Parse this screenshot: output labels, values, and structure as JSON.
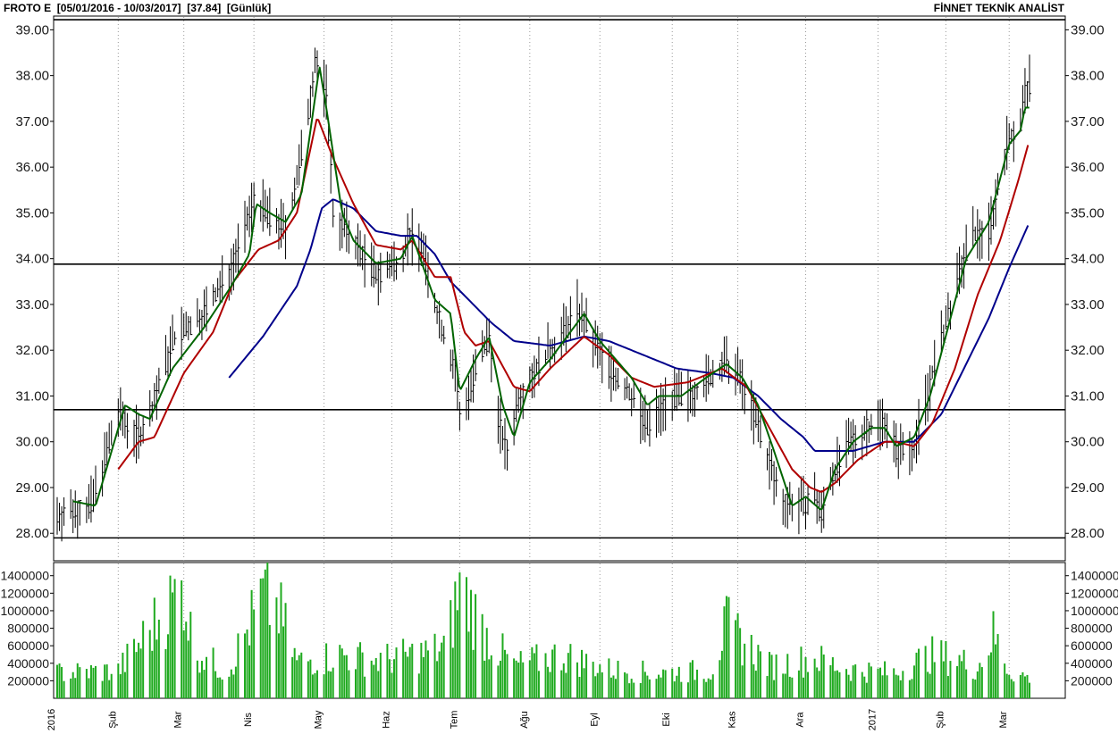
{
  "header": {
    "left": "FROTO E  [05/01/2016 - 10/03/2017]  [37.84]  [Günlük]",
    "right": "FİNNET TEKNİK ANALİST"
  },
  "colors": {
    "price_bars": "#000000",
    "ma_short": "#006400",
    "ma_mid": "#b00000",
    "ma_long": "#00008b",
    "volume": "#1faa1f",
    "grid": "#9a9a9a",
    "level_lines": "#000000"
  },
  "chart_data": [
    {
      "type": "line",
      "title": "",
      "ylim": [
        27.4,
        39.3
      ],
      "y_ticks": [
        "28.00",
        "29.00",
        "30.00",
        "31.00",
        "32.00",
        "33.00",
        "34.00",
        "35.00",
        "36.00",
        "37.00",
        "38.00",
        "39.00"
      ],
      "x_ticks": [
        "2016",
        "Şub",
        "Mar",
        "Nis",
        "May",
        "Haz",
        "Tem",
        "Ağu",
        "Eyl",
        "Eki",
        "Kas",
        "Ara",
        "2017",
        "Şub",
        "Mar"
      ],
      "grid": true,
      "horizontal_levels": [
        39.22,
        33.88,
        30.7,
        27.9
      ],
      "price_anchors": [
        [
          "2016-01-05",
          28.4
        ],
        [
          "2016-01-20",
          28.6
        ],
        [
          "2016-02-01",
          30.6
        ],
        [
          "2016-02-10",
          30.1
        ],
        [
          "2016-02-15",
          30.6
        ],
        [
          "2016-02-25",
          32.2
        ],
        [
          "2016-03-10",
          32.8
        ],
        [
          "2016-03-21",
          33.7
        ],
        [
          "2016-03-28",
          34.6
        ],
        [
          "2016-04-01",
          35.3
        ],
        [
          "2016-04-08",
          34.9
        ],
        [
          "2016-04-15",
          34.6
        ],
        [
          "2016-04-22",
          36.2
        ],
        [
          "2016-04-28",
          38.3
        ],
        [
          "2016-05-03",
          37.6
        ],
        [
          "2016-05-06",
          35.0
        ],
        [
          "2016-05-15",
          34.4
        ],
        [
          "2016-05-25",
          33.6
        ],
        [
          "2016-06-05",
          34.0
        ],
        [
          "2016-06-08",
          34.5
        ],
        [
          "2016-06-14",
          34.3
        ],
        [
          "2016-06-20",
          33.0
        ],
        [
          "2016-06-29",
          31.5
        ],
        [
          "2016-07-01",
          30.5
        ],
        [
          "2016-07-08",
          31.5
        ],
        [
          "2016-07-14",
          32.3
        ],
        [
          "2016-07-18",
          30.5
        ],
        [
          "2016-07-22",
          29.7
        ],
        [
          "2016-07-27",
          31.0
        ],
        [
          "2016-08-05",
          31.7
        ],
        [
          "2016-08-15",
          32.3
        ],
        [
          "2016-08-22",
          32.9
        ],
        [
          "2016-08-29",
          32.2
        ],
        [
          "2016-09-05",
          31.6
        ],
        [
          "2016-09-15",
          31.0
        ],
        [
          "2016-09-22",
          30.3
        ],
        [
          "2016-09-30",
          30.9
        ],
        [
          "2016-10-10",
          31.0
        ],
        [
          "2016-10-18",
          31.3
        ],
        [
          "2016-10-26",
          31.7
        ],
        [
          "2016-11-02",
          31.4
        ],
        [
          "2016-11-10",
          30.3
        ],
        [
          "2016-11-20",
          28.7
        ],
        [
          "2016-11-30",
          28.6
        ],
        [
          "2016-12-05",
          28.8
        ],
        [
          "2016-12-08",
          28.4
        ],
        [
          "2016-12-12",
          29.2
        ],
        [
          "2016-12-20",
          29.9
        ],
        [
          "2016-12-28",
          30.3
        ],
        [
          "2017-01-05",
          30.5
        ],
        [
          "2017-01-10",
          29.8
        ],
        [
          "2017-01-18",
          29.9
        ],
        [
          "2017-01-26",
          31.5
        ],
        [
          "2017-02-05",
          33.3
        ],
        [
          "2017-02-12",
          34.5
        ],
        [
          "2017-02-20",
          34.6
        ],
        [
          "2017-02-28",
          36.5
        ],
        [
          "2017-03-06",
          37.0
        ],
        [
          "2017-03-08",
          37.6
        ],
        [
          "2017-03-10",
          37.8
        ]
      ],
      "ma_short_anchors": [
        [
          "2016-01-12",
          28.7
        ],
        [
          "2016-01-22",
          28.6
        ],
        [
          "2016-02-04",
          30.8
        ],
        [
          "2016-02-10",
          30.6
        ],
        [
          "2016-02-15",
          30.5
        ],
        [
          "2016-02-25",
          31.6
        ],
        [
          "2016-03-10",
          32.5
        ],
        [
          "2016-03-22",
          33.4
        ],
        [
          "2016-03-30",
          34.1
        ],
        [
          "2016-04-02",
          35.2
        ],
        [
          "2016-04-08",
          35.0
        ],
        [
          "2016-04-15",
          34.8
        ],
        [
          "2016-04-22",
          35.4
        ],
        [
          "2016-04-30",
          38.2
        ],
        [
          "2016-05-03",
          37.3
        ],
        [
          "2016-05-10",
          35.0
        ],
        [
          "2016-05-15",
          34.4
        ],
        [
          "2016-05-25",
          33.9
        ],
        [
          "2016-06-05",
          34.0
        ],
        [
          "2016-06-10",
          34.5
        ],
        [
          "2016-06-20",
          33.1
        ],
        [
          "2016-06-27",
          32.8
        ],
        [
          "2016-07-01",
          31.1
        ],
        [
          "2016-07-08",
          31.8
        ],
        [
          "2016-07-14",
          32.3
        ],
        [
          "2016-07-20",
          30.8
        ],
        [
          "2016-07-25",
          30.1
        ],
        [
          "2016-08-01",
          31.3
        ],
        [
          "2016-08-10",
          31.8
        ],
        [
          "2016-08-25",
          32.8
        ],
        [
          "2016-09-01",
          32.2
        ],
        [
          "2016-09-08",
          31.8
        ],
        [
          "2016-09-15",
          31.4
        ],
        [
          "2016-09-22",
          30.8
        ],
        [
          "2016-09-27",
          31.0
        ],
        [
          "2016-10-07",
          31.0
        ],
        [
          "2016-10-18",
          31.4
        ],
        [
          "2016-10-27",
          31.7
        ],
        [
          "2016-11-03",
          31.4
        ],
        [
          "2016-11-10",
          30.8
        ],
        [
          "2016-11-17",
          29.8
        ],
        [
          "2016-11-25",
          28.6
        ],
        [
          "2016-12-01",
          28.8
        ],
        [
          "2016-12-08",
          28.5
        ],
        [
          "2016-12-14",
          29.4
        ],
        [
          "2016-12-22",
          30.0
        ],
        [
          "2016-12-30",
          30.3
        ],
        [
          "2017-01-05",
          30.3
        ],
        [
          "2017-01-10",
          29.9
        ],
        [
          "2017-01-18",
          30.1
        ],
        [
          "2017-01-25",
          31.0
        ],
        [
          "2017-02-02",
          32.5
        ],
        [
          "2017-02-10",
          34.0
        ],
        [
          "2017-02-20",
          34.8
        ],
        [
          "2017-03-01",
          36.5
        ],
        [
          "2017-03-06",
          36.8
        ],
        [
          "2017-03-08",
          37.3
        ],
        [
          "2017-03-10",
          37.3
        ]
      ],
      "ma_mid_anchors": [
        [
          "2016-02-01",
          29.4
        ],
        [
          "2016-02-10",
          30.0
        ],
        [
          "2016-02-17",
          30.1
        ],
        [
          "2016-03-01",
          31.5
        ],
        [
          "2016-03-14",
          32.4
        ],
        [
          "2016-03-23",
          33.5
        ],
        [
          "2016-04-03",
          34.2
        ],
        [
          "2016-04-12",
          34.4
        ],
        [
          "2016-04-20",
          35.0
        ],
        [
          "2016-04-29",
          37.1
        ],
        [
          "2016-05-06",
          36.2
        ],
        [
          "2016-05-15",
          35.2
        ],
        [
          "2016-05-25",
          34.3
        ],
        [
          "2016-06-05",
          34.2
        ],
        [
          "2016-06-10",
          34.4
        ],
        [
          "2016-06-20",
          33.6
        ],
        [
          "2016-06-27",
          33.6
        ],
        [
          "2016-07-03",
          32.4
        ],
        [
          "2016-07-08",
          32.1
        ],
        [
          "2016-07-14",
          32.2
        ],
        [
          "2016-07-25",
          31.2
        ],
        [
          "2016-08-01",
          31.1
        ],
        [
          "2016-08-10",
          31.6
        ],
        [
          "2016-08-25",
          32.3
        ],
        [
          "2016-09-05",
          31.9
        ],
        [
          "2016-09-15",
          31.4
        ],
        [
          "2016-09-25",
          31.2
        ],
        [
          "2016-10-10",
          31.3
        ],
        [
          "2016-10-25",
          31.6
        ],
        [
          "2016-11-05",
          31.2
        ],
        [
          "2016-11-15",
          30.3
        ],
        [
          "2016-11-25",
          29.4
        ],
        [
          "2016-12-03",
          29.0
        ],
        [
          "2016-12-08",
          28.9
        ],
        [
          "2016-12-14",
          29.1
        ],
        [
          "2016-12-24",
          29.6
        ],
        [
          "2017-01-05",
          30.0
        ],
        [
          "2017-01-10",
          30.0
        ],
        [
          "2017-01-18",
          29.9
        ],
        [
          "2017-01-26",
          30.4
        ],
        [
          "2017-02-05",
          31.6
        ],
        [
          "2017-02-15",
          33.2
        ],
        [
          "2017-02-25",
          34.4
        ],
        [
          "2017-03-05",
          35.7
        ],
        [
          "2017-03-10",
          36.6
        ]
      ],
      "ma_long_anchors": [
        [
          "2016-03-21",
          31.4
        ],
        [
          "2016-04-05",
          32.3
        ],
        [
          "2016-04-20",
          33.4
        ],
        [
          "2016-04-26",
          34.2
        ],
        [
          "2016-05-01",
          35.1
        ],
        [
          "2016-05-06",
          35.3
        ],
        [
          "2016-05-15",
          35.1
        ],
        [
          "2016-05-25",
          34.6
        ],
        [
          "2016-06-05",
          34.5
        ],
        [
          "2016-06-12",
          34.5
        ],
        [
          "2016-06-20",
          34.1
        ],
        [
          "2016-06-27",
          33.5
        ],
        [
          "2016-07-05",
          33.1
        ],
        [
          "2016-07-15",
          32.6
        ],
        [
          "2016-07-25",
          32.2
        ],
        [
          "2016-08-10",
          32.1
        ],
        [
          "2016-08-25",
          32.3
        ],
        [
          "2016-09-05",
          32.2
        ],
        [
          "2016-09-20",
          31.9
        ],
        [
          "2016-10-05",
          31.6
        ],
        [
          "2016-10-20",
          31.5
        ],
        [
          "2016-10-30",
          31.4
        ],
        [
          "2016-11-10",
          31.0
        ],
        [
          "2016-11-20",
          30.5
        ],
        [
          "2016-11-30",
          30.1
        ],
        [
          "2016-12-05",
          29.8
        ],
        [
          "2016-12-12",
          29.8
        ],
        [
          "2016-12-22",
          29.8
        ],
        [
          "2017-01-05",
          30.0
        ],
        [
          "2017-01-18",
          30.0
        ],
        [
          "2017-01-30",
          30.6
        ],
        [
          "2017-02-10",
          31.7
        ],
        [
          "2017-02-20",
          32.7
        ],
        [
          "2017-03-01",
          33.8
        ],
        [
          "2017-03-10",
          34.8
        ]
      ]
    },
    {
      "type": "bar",
      "title": "",
      "ylim": [
        0,
        1550000
      ],
      "y_ticks": [
        "200000",
        "400000",
        "600000",
        "800000",
        "1000000",
        "1200000",
        "1400000"
      ],
      "y_tick_values": [
        200000,
        400000,
        600000,
        800000,
        1000000,
        1200000,
        1400000
      ],
      "volume_anchors": [
        [
          "2016-01-05",
          350000
        ],
        [
          "2016-02-01",
          380000
        ],
        [
          "2016-03-01",
          1550000
        ],
        [
          "2016-03-05",
          700000
        ],
        [
          "2016-03-20",
          350000
        ],
        [
          "2016-04-05",
          1400000
        ],
        [
          "2016-04-12",
          1200000
        ],
        [
          "2016-04-20",
          500000
        ],
        [
          "2016-05-10",
          600000
        ],
        [
          "2016-05-25",
          520000
        ],
        [
          "2016-06-15",
          620000
        ],
        [
          "2016-06-25",
          700000
        ],
        [
          "2016-07-01",
          1550000
        ],
        [
          "2016-07-12",
          900000
        ],
        [
          "2016-07-25",
          450000
        ],
        [
          "2016-08-15",
          600000
        ],
        [
          "2016-09-05",
          400000
        ],
        [
          "2016-09-25",
          350000
        ],
        [
          "2016-10-20",
          380000
        ],
        [
          "2016-10-27",
          1000000
        ],
        [
          "2016-11-15",
          450000
        ],
        [
          "2016-12-05",
          550000
        ],
        [
          "2016-12-20",
          400000
        ],
        [
          "2017-01-10",
          350000
        ],
        [
          "2017-01-25",
          600000
        ],
        [
          "2017-02-05",
          550000
        ],
        [
          "2017-02-15",
          420000
        ],
        [
          "2017-02-22",
          880000
        ],
        [
          "2017-03-01",
          380000
        ],
        [
          "2017-03-10",
          280000
        ]
      ]
    }
  ]
}
